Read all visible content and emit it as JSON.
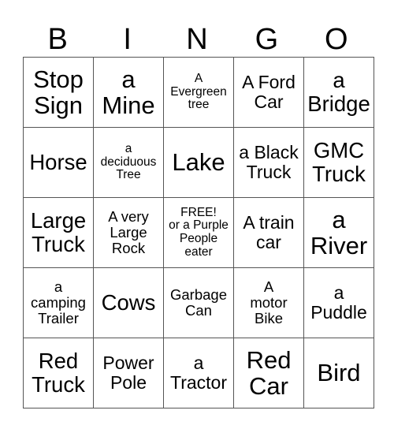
{
  "header": [
    "B",
    "I",
    "N",
    "G",
    "O"
  ],
  "cells": [
    [
      "Stop\nSign",
      "a\nMine",
      "A\nEvergreen\ntree",
      "A Ford\nCar",
      "a\nBridge"
    ],
    [
      "Horse",
      "a\ndeciduous\nTree",
      "Lake",
      "a Black\nTruck",
      "GMC\nTruck"
    ],
    [
      "Large\nTruck",
      "A very\nLarge\nRock",
      "FREE!\nor a Purple\nPeople\neater",
      "A train\ncar",
      "a\nRiver"
    ],
    [
      "a\ncamping\nTrailer",
      "Cows",
      "Garbage\nCan",
      "A\nmotor\nBike",
      "a\nPuddle"
    ],
    [
      "Red\nTruck",
      "Power\nPole",
      "a\nTractor",
      "Red\nCar",
      "Bird"
    ]
  ]
}
